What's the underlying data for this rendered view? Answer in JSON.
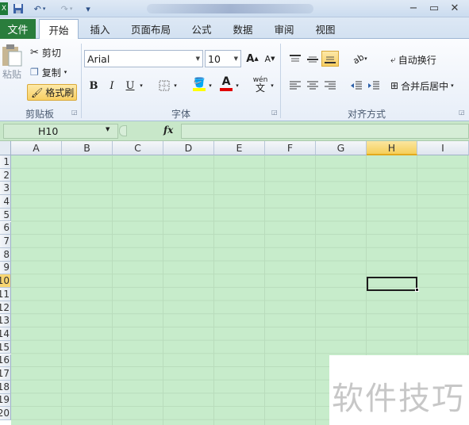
{
  "ribbon_tabs": {
    "file": "文件",
    "home": "开始",
    "insert": "插入",
    "page_layout": "页面布局",
    "formulas": "公式",
    "data": "数据",
    "review": "审阅",
    "view": "视图"
  },
  "clipboard": {
    "paste": "粘贴",
    "cut": "剪切",
    "copy": "复制",
    "format_painter": "格式刷",
    "group_label": "剪贴板"
  },
  "font": {
    "name": "Arial",
    "size": "10",
    "bold": "B",
    "italic": "I",
    "underline": "U",
    "color_letter": "A",
    "phonetic": "wén",
    "group_label": "字体",
    "grow_icon": "A",
    "shrink_icon": "A"
  },
  "alignment": {
    "wrap_text": "自动换行",
    "merge_center": "合并后居中",
    "group_label": "对齐方式"
  },
  "formula_bar": {
    "name_box": "H10",
    "fx": "fx",
    "formula": ""
  },
  "sheet": {
    "columns": [
      "A",
      "B",
      "C",
      "D",
      "E",
      "F",
      "G",
      "H",
      "I"
    ],
    "selected_column": "H",
    "selected_row": "10",
    "rows": [
      "1",
      "2",
      "3",
      "4",
      "5",
      "6",
      "7",
      "8",
      "9",
      "10",
      "11",
      "12",
      "13",
      "14",
      "15",
      "16",
      "17",
      "18",
      "19",
      "20"
    ],
    "grid_color": "#c7eccb",
    "accent_color": "#f5cf5a"
  },
  "watermark": "软件技巧",
  "colors": {
    "file_tab": "#2a7d3c",
    "highlight_yellow": "#ffff00",
    "font_red": "#e00000"
  }
}
